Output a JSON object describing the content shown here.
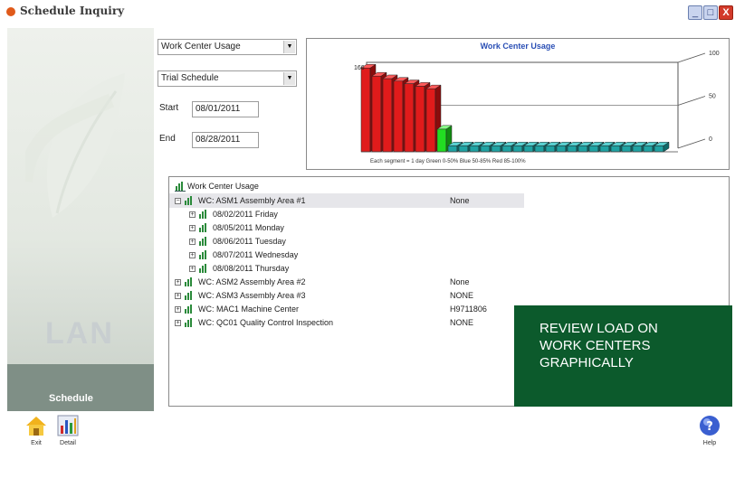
{
  "window": {
    "title": "Schedule Inquiry",
    "controls": {
      "minimize": "_",
      "maximize": "□",
      "close": "X"
    }
  },
  "branding": {
    "logo_text": "LAN",
    "badge_text": "Schedule"
  },
  "filters": {
    "report_select": "Work Center Usage",
    "schedule_select": "Trial Schedule",
    "start_label": "Start",
    "start_value": "08/01/2011",
    "end_label": "End",
    "end_value": "08/28/2011"
  },
  "chart_data": {
    "type": "bar",
    "title": "Work Center Usage",
    "footer": "Each segment = 1 day    Green 0-50%  Blue 50-85%  Red 85-100%",
    "peak_label": "166",
    "axis_labels": [
      "100",
      "50",
      "0"
    ],
    "x": [
      1,
      2,
      3,
      4,
      5,
      6,
      7,
      8,
      9,
      10,
      11,
      12,
      13,
      14,
      15,
      16,
      17,
      18,
      19,
      20,
      21,
      22,
      23,
      24,
      25,
      26,
      27,
      28
    ],
    "values": [
      166,
      150,
      145,
      140,
      135,
      130,
      125,
      45,
      12,
      12,
      12,
      12,
      12,
      12,
      12,
      12,
      12,
      12,
      12,
      12,
      12,
      12,
      12,
      12,
      12,
      12,
      12,
      12
    ],
    "colors": {
      "red": "#e01b1b",
      "green": "#22dd22",
      "teal": "#1fa3a3"
    }
  },
  "tree": {
    "root_label": "Work Center Usage",
    "items": [
      {
        "label": "WC: ASM1  Assembly Area #1",
        "value": "None",
        "expanded": true
      },
      {
        "label": "08/02/2011 Friday",
        "value": "",
        "child": true
      },
      {
        "label": "08/05/2011 Monday",
        "value": "",
        "child": true
      },
      {
        "label": "08/06/2011 Tuesday",
        "value": "",
        "child": true
      },
      {
        "label": "08/07/2011 Wednesday",
        "value": "",
        "child": true
      },
      {
        "label": "08/08/2011 Thursday",
        "value": "",
        "child": true
      },
      {
        "label": "WC: ASM2  Assembly Area #2",
        "value": "None"
      },
      {
        "label": "WC: ASM3  Assembly Area #3",
        "value": "NONE"
      },
      {
        "label": "WC: MAC1  Machine Center",
        "value": "H9711806"
      },
      {
        "label": "WC: QC01  Quality Control Inspection",
        "value": "NONE"
      }
    ]
  },
  "callout": {
    "text": "REVIEW LOAD ON\nWORK CENTERS\nGRAPHICALLY"
  },
  "toolbar": {
    "exit_label": "Exit",
    "detail_label": "Detail",
    "help_label": "Help"
  }
}
